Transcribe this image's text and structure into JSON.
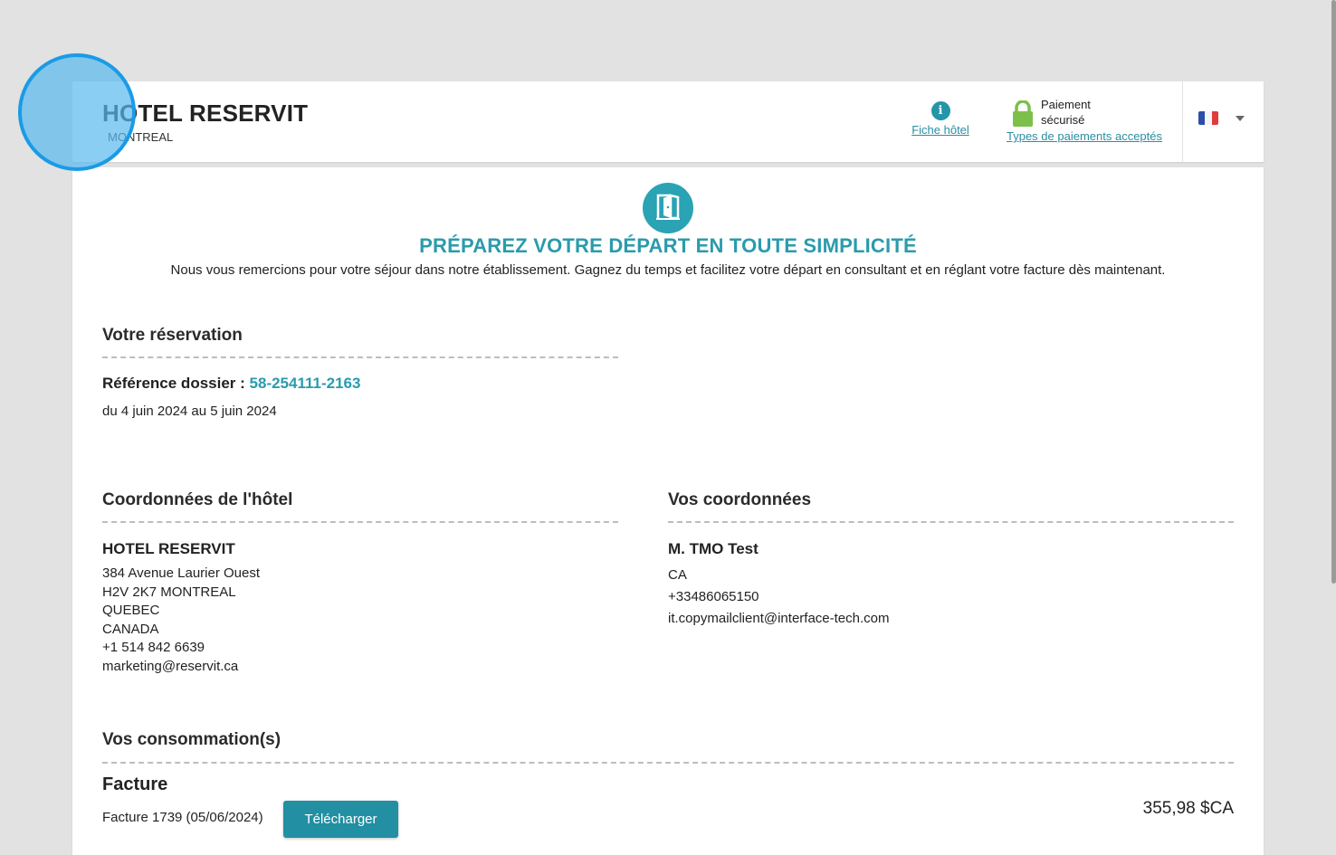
{
  "header": {
    "hotel_name": "HOTEL RESERVIT",
    "city": "MONTREAL",
    "fiche_label": "Fiche hôtel",
    "secure_line1": "Paiement",
    "secure_line2": "sécurisé",
    "payment_types_link": "Types de paiements acceptés",
    "language_flag": "fr",
    "icons": [
      "info-icon",
      "lock-icon",
      "flag-fr-icon",
      "chevron-down-icon"
    ]
  },
  "main": {
    "icon": "door-exit-icon",
    "title": "PRÉPAREZ VOTRE DÉPART EN TOUTE SIMPLICITÉ",
    "intro": "Nous vous remercions pour votre séjour dans notre établissement. Gagnez du temps et facilitez votre départ en consultant et en réglant votre facture dès maintenant."
  },
  "reservation": {
    "title": "Votre réservation",
    "ref_label": "Référence dossier :",
    "ref_number": "58-254111-2163",
    "dates": "du 4 juin 2024 au 5 juin 2024"
  },
  "hotel_contact": {
    "title": "Coordonnées de l'hôtel",
    "name": "HOTEL RESERVIT",
    "lines": [
      "384 Avenue Laurier Ouest",
      "H2V 2K7 MONTREAL",
      "QUEBEC",
      "CANADA",
      "+1 514 842 6639",
      "marketing@reservit.ca"
    ]
  },
  "guest_contact": {
    "title": "Vos coordonnées",
    "name": "M. TMO Test",
    "lines": [
      "CA",
      "+33486065150",
      "it.copymailclient@interface-tech.com"
    ]
  },
  "consumption": {
    "title": "Vos consommation(s)",
    "invoice_title": "Facture",
    "invoice_line": "Facture 1739 (05/06/2024)",
    "download_label": "Télécharger",
    "amount": "355,98 $CA"
  },
  "colors": {
    "accent": "#2a9bad",
    "button": "#228fa2",
    "lock": "#7cc04b",
    "click_indicator": "#1a9be6"
  }
}
